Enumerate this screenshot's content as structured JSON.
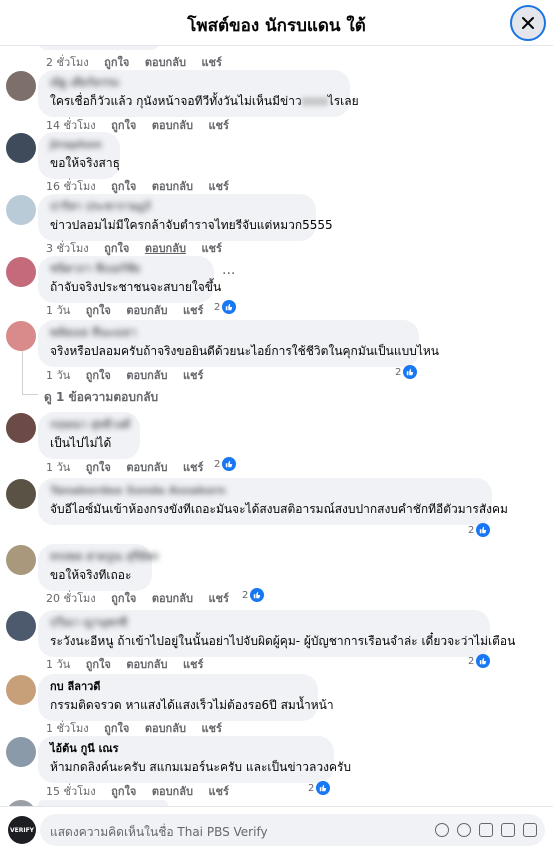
{
  "header": {
    "title": "โพสต์ของ นักรบแดน ใต้"
  },
  "actions": {
    "like": "ถูกใจ",
    "reply": "ตอบกลับ",
    "share": "แชร์"
  },
  "comments": [
    {
      "name": "",
      "text": "",
      "time": "2 ชั่วโมง",
      "likes": ""
    },
    {
      "name": "ณัฐ เดียร์ธรรม",
      "text_before": "ใครเชื่อก็วัวแล้ว กุนังหน้าจอทีวีทั้งวันไม่เห็นมีข่าว",
      "text_after": "ไรเลย",
      "time": "14 ชั่วโมง",
      "likes": ""
    },
    {
      "name": "Jiraphon",
      "text": "ขอให้จริงสาธุ",
      "time": "16 ชั่วโมง",
      "likes": ""
    },
    {
      "name": "ปาริสา ประชาราษฎร์",
      "text": "ข่าวปลอมไม่มีใครกล้าจับตำราจไทยรีจับแต่หมวก5555",
      "time": "3 ชั่วโมง",
      "likes": ""
    },
    {
      "name": "ชนิดาภา ทีเบอร์ชัย",
      "text": "ถ้าจับจริงประชาชนจะสบายใจขึ้น",
      "time": "1 วัน",
      "likes": "2"
    },
    {
      "name": "พลัยเมธ ทีนะเมธา",
      "text": "จริงหรือปลอมครับถ้าจริงขอยินดีด้วยนะไอย์การใช้ชีวิตในคุกมันเป็นแบบไหน",
      "time": "1 วัน",
      "likes": "2"
    },
    {
      "name": "กฤษณา สุทธิวงศ์",
      "text": "เป็นไปไม่ได้",
      "time": "1 วัน",
      "likes": "2"
    },
    {
      "name": "Tanabordee Sonda Assakorn",
      "text": "จับอีไอซ์มันเข้าห้องกรงขังทีเถอะมันจะได้สงบสติอารมณ์สงบปากสงบคำชักทีอีตัวมารสังคม",
      "time": "",
      "likes": "2"
    },
    {
      "name": "ทรงพล ฮาดรูณ สุรีย์พร",
      "text": "ขอให้จริงทีเถอะ",
      "time": "20 ชั่วโมง",
      "likes": "2"
    },
    {
      "name": "ปวีณา ญานุพรชี",
      "text": "ระวังนะอีหนู ถ้าเข้าไปอยู่ในนั้นอย่าไปจับผิดผู้คุม- ผู้บัญชาการเรือนจำล่ะ เดี๋ยวจะว่าไม่เตือน",
      "time": "1 วัน",
      "likes": "2"
    },
    {
      "name": "กบ ลีลาวดี",
      "text": "กรรมติดจรวด หาแสงได้แสงเร็วไม่ต้องรอ6ปี สมน้ำหน้า",
      "time": "1 ชั่วโมง",
      "likes": ""
    },
    {
      "name": "ไอ้ต้น กูนี เณร",
      "text": "ห้ามกดลิงค์นะครับ สแกมเมอร์นะครับ และเป็นข่าวลวงครับ",
      "time": "15 ชั่วโมง",
      "likes": "2"
    }
  ],
  "view_replies": "ดู 1 ข้อความตอบกลับ",
  "more": "···",
  "footer": {
    "page_logo": "VERIFY",
    "placeholder": "แสดงความคิดเห็นในชื่อ Thai PBS Verify"
  }
}
